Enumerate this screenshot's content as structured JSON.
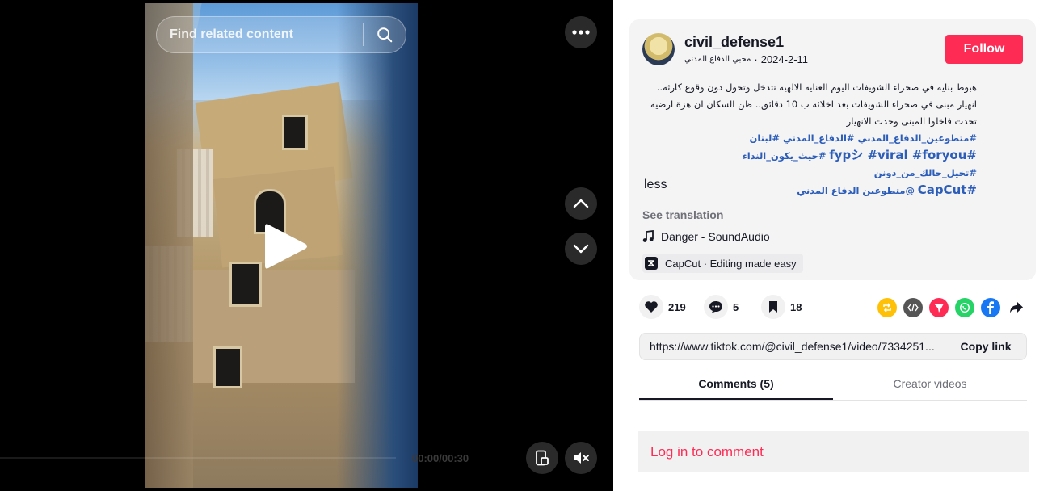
{
  "search": {
    "placeholder": "Find related content"
  },
  "player": {
    "time": "00:00/00:30",
    "progress": 0
  },
  "author": {
    "username": "civil_defense1",
    "nickname": "محبي الدفاع المدني",
    "separator": "·",
    "date": "2024-2-11",
    "follow_label": "Follow"
  },
  "caption": {
    "text": "هبوط بناية في صحراء الشويفات اليوم العناية الالهية تتدخل وتحول دون وقوع كارثة.. انهيار مبنى في صحراء الشويفات بعد اخلائه ب 10 دقائق.. ظن السكان ان هزة ارضية تحدث فاخلوا المبنى وحدث الانهيار",
    "hashtags_line1": "#متطوعين_الدفاع_المدني #الدفاع_المدني #لبنان",
    "hashtags_line2": "#حيث_يكون_النداء #تخيل_حالك_من_دونن",
    "hashtags_line2_latin": "#fypシ #viral #foryou",
    "hashtags_line3": "@متطوعين الدفاع المدني",
    "hashtags_line3_latin": "#CapCut"
  },
  "less_label": "less",
  "see_translation": "See translation",
  "music": "Danger - SoundAudio",
  "capcut": "CapCut · Editing made easy",
  "stats": {
    "likes": "219",
    "comments": "5",
    "saves": "18"
  },
  "share_icons": [
    {
      "name": "repost-icon",
      "color": "#ffc107"
    },
    {
      "name": "embed-icon",
      "color": "#555555"
    },
    {
      "name": "send-icon",
      "color": "#fe2c55"
    },
    {
      "name": "whatsapp-icon",
      "color": "#25d366"
    },
    {
      "name": "facebook-icon",
      "color": "#1877f2"
    }
  ],
  "link": {
    "url": "https://www.tiktok.com/@civil_defense1/video/7334251...",
    "copy_label": "Copy link"
  },
  "tabs": [
    {
      "label": "Comments (5)"
    },
    {
      "label": "Creator videos"
    }
  ],
  "login_label": "Log in to comment"
}
